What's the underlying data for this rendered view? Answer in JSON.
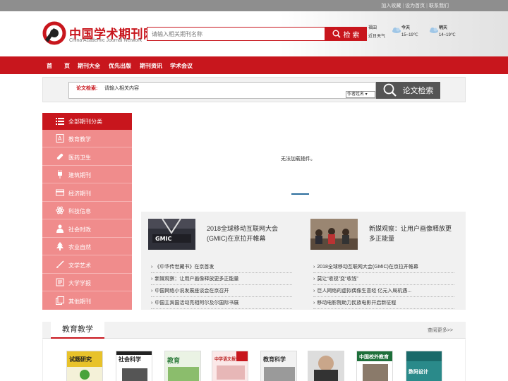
{
  "topbar": {
    "links": [
      "加入收藏",
      "设为首页",
      "联系我们"
    ]
  },
  "header": {
    "logo_cn": "中国学术期刊网",
    "logo_en": "China Academic Journal Network",
    "search_placeholder": "请输入相关期刊名称",
    "search_button": "检 索",
    "weather": [
      {
        "label": "福田",
        "sub": "近日天气"
      },
      {
        "label": "今天",
        "sub": "15~19℃"
      },
      {
        "label": "明天",
        "sub": "14~19℃"
      }
    ]
  },
  "nav": {
    "items": [
      "首",
      "页",
      "期刊大全",
      "优先出版",
      "期刊资讯",
      "学术会议"
    ]
  },
  "subsearch": {
    "label": "论文检索:",
    "placeholder": "请输入相关内容",
    "select_value": "作者姓名",
    "button": "论文检索"
  },
  "sidebar": {
    "header": "全部期刊分类",
    "items": [
      {
        "label": "教育教学",
        "icon": "book-a-icon"
      },
      {
        "label": "医药卫生",
        "icon": "pill-icon"
      },
      {
        "label": "建筑期刊",
        "icon": "plug-icon"
      },
      {
        "label": "经济期刊",
        "icon": "card-icon"
      },
      {
        "label": "科技信息",
        "icon": "atom-icon"
      },
      {
        "label": "社会时政",
        "icon": "person-icon"
      },
      {
        "label": "农业自然",
        "icon": "tree-icon"
      },
      {
        "label": "文学艺术",
        "icon": "brush-icon"
      },
      {
        "label": "大学学报",
        "icon": "journal-icon"
      },
      {
        "label": "其他期刊",
        "icon": "copy-icon"
      }
    ]
  },
  "banner": {
    "message": "无法加载插件。"
  },
  "news": {
    "featured": [
      {
        "title": "2018全球移动互联网大会(GMIC)在京拉开帷幕",
        "thumb_text": "GMIC"
      },
      {
        "title": "新媒观察：让用户画像释放更多正能量"
      }
    ],
    "left_list": [
      "《中华传世藏书》在京首发",
      "新媒观察：让用户画像释放更多正能量",
      "中国网络小说发展座谈会在京召开",
      "中国主宾国活动亮相阿尔及尔国际书展"
    ],
    "right_list": [
      "2018全球移动互联网大会(GMIC)在京拉开帷幕",
      "莫让“收视”变“收钱”",
      "巨人网络的虚拟偶像生意经 亿元入局机遇...",
      "移动电影院助力民族电影开启新征程"
    ]
  },
  "education": {
    "title": "教育教学",
    "more": "查阅更多>>",
    "covers": [
      {
        "text": "试题研究"
      },
      {
        "text": "社会科学"
      },
      {
        "text": "教育"
      },
      {
        "text": "中学语文报告"
      },
      {
        "text": "教育科学"
      },
      {
        "text": ""
      },
      {
        "text": "中国校外教育"
      },
      {
        "text": "数码设计"
      }
    ]
  }
}
